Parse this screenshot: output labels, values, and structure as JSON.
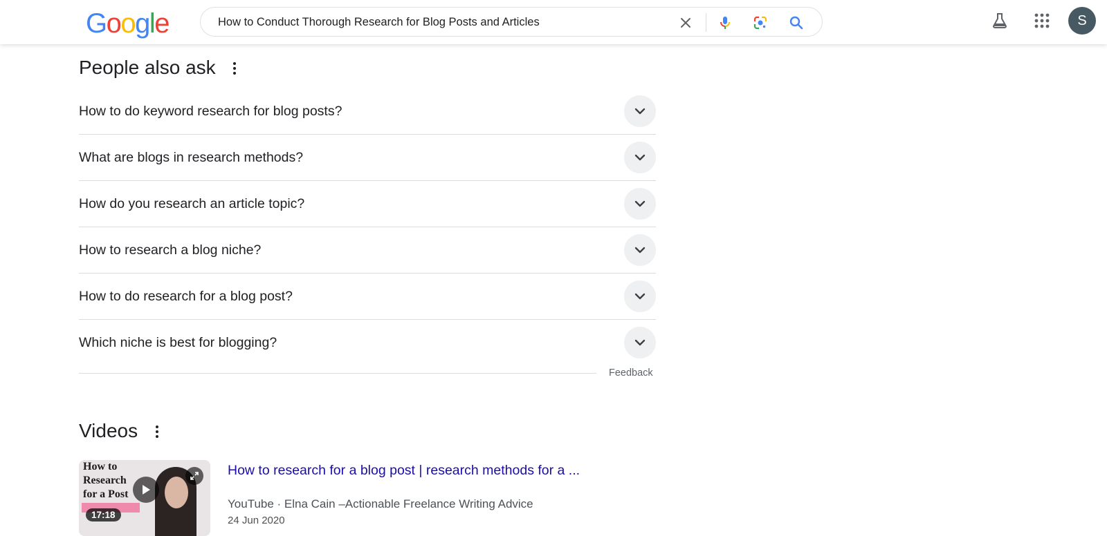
{
  "header": {
    "logo_letters": [
      {
        "char": "G",
        "color": "#4285F4"
      },
      {
        "char": "o",
        "color": "#EA4335"
      },
      {
        "char": "o",
        "color": "#FBBC05"
      },
      {
        "char": "g",
        "color": "#4285F4"
      },
      {
        "char": "l",
        "color": "#34A853"
      },
      {
        "char": "e",
        "color": "#EA4335"
      }
    ],
    "search_query": "How to Conduct Thorough Research for Blog Posts and Articles",
    "icons": {
      "clear": "close-icon",
      "voice": "microphone-icon",
      "lens": "google-lens-icon",
      "search": "search-icon",
      "labs": "flask-icon",
      "apps": "apps-grid-icon"
    },
    "avatar_initial": "S"
  },
  "people_also_ask": {
    "title": "People also ask",
    "questions": [
      "How to do keyword research for blog posts?",
      "What are blogs in research methods?",
      "How do you research an article topic?",
      "How to research a blog niche?",
      "How to do research for a blog post?",
      "Which niche is best for blogging?"
    ],
    "feedback_label": "Feedback"
  },
  "videos": {
    "title": "Videos",
    "items": [
      {
        "thumbnail_text": "How to\nResearch\nfor a Post",
        "duration": "17:18",
        "title": "How to research for a blog post | research methods for a ...",
        "source": "YouTube · Elna Cain –Actionable Freelance Writing Advice",
        "date": "24 Jun 2020"
      }
    ]
  },
  "colors": {
    "link": "#1a0dab",
    "text": "#202124",
    "secondary_text": "#4d5156",
    "divider": "#dadce0",
    "avatar_bg": "#475a64"
  }
}
